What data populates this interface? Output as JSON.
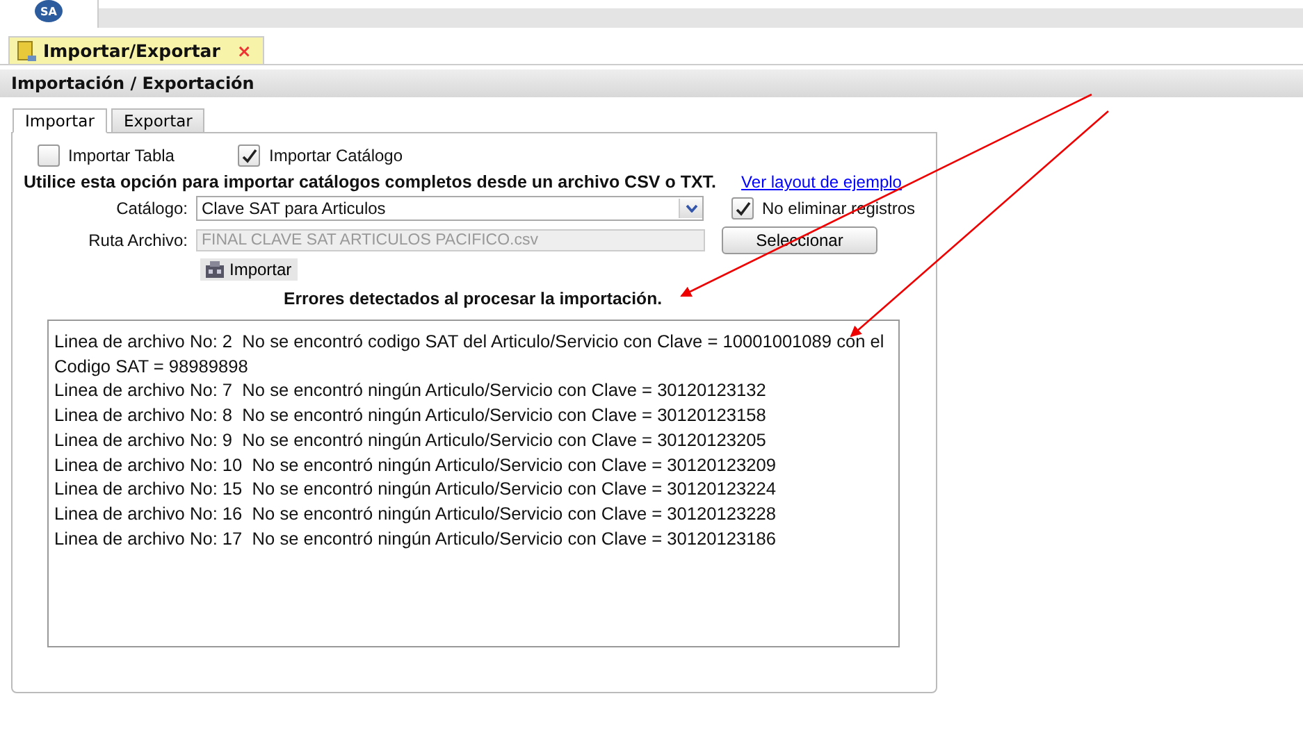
{
  "app_logo": {
    "label": "SA"
  },
  "document_tabs": [
    {
      "label": "Importar/Exportar",
      "selected": true,
      "close": "×"
    }
  ],
  "header": {
    "title": "Importación / Exportación"
  },
  "tabs": [
    {
      "label": "Importar",
      "selected": true
    },
    {
      "label": "Exportar",
      "selected": false
    }
  ],
  "import_options": [
    {
      "label": "Importar Tabla",
      "checked": false
    },
    {
      "label": "Importar Catálogo",
      "checked": true
    }
  ],
  "instructions": "Utilice esta opción para importar catálogos completos desde un archivo CSV o TXT.",
  "layout_link": "Ver layout de ejemplo",
  "catalog": {
    "label": "Catálogo:",
    "value": "Clave SAT para Articulos"
  },
  "keep_records": {
    "label": "No eliminar registros",
    "checked": true
  },
  "file_path": {
    "label": "Ruta Archivo:",
    "value": "FINAL CLAVE SAT ARTICULOS PACIFICO.csv",
    "disabled": true
  },
  "select_button": "Seleccionar",
  "import_button": "Importar",
  "errors_title": "Errores detectados al procesar la importación.",
  "errors": [
    "Linea de archivo No: 2  No se encontró codigo SAT del Articulo/Servicio con Clave = 10001001089 con el Codigo SAT = 98989898",
    "Linea de archivo No: 7  No se encontró ningún Articulo/Servicio con Clave = 30120123132",
    "Linea de archivo No: 8  No se encontró ningún Articulo/Servicio con Clave = 30120123158",
    "Linea de archivo No: 9  No se encontró ningún Articulo/Servicio con Clave = 30120123205",
    "Linea de archivo No: 10  No se encontró ningún Articulo/Servicio con Clave = 30120123209",
    "Linea de archivo No: 15  No se encontró ningún Articulo/Servicio con Clave = 30120123224",
    "Linea de archivo No: 16  No se encontró ningún Articulo/Servicio con Clave = 30120123228",
    "Linea de archivo No: 17  No se encontró ningún Articulo/Servicio con Clave = 30120123186"
  ]
}
